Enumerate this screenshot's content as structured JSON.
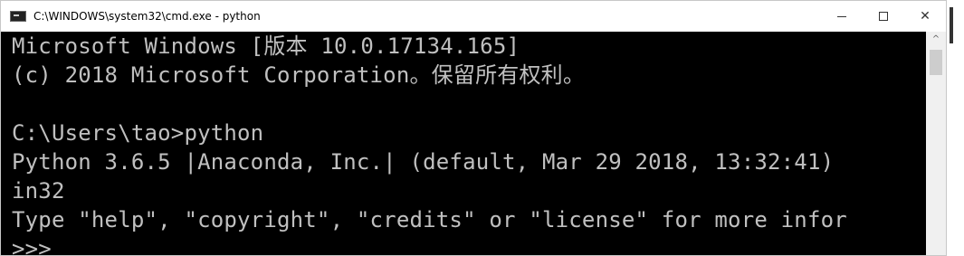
{
  "window": {
    "title": "C:\\WINDOWS\\system32\\cmd.exe - python",
    "icon": "cmd-icon",
    "minimize_label": "–",
    "close_label": "✕"
  },
  "console": {
    "lines": [
      "Microsoft Windows [版本 10.0.17134.165]",
      "(c) 2018 Microsoft Corporation。保留所有权利。",
      "",
      "C:\\Users\\tao>python",
      "Python 3.6.5 |Anaconda, Inc.| (default, Mar 29 2018, 13:32:41)",
      "in32",
      "Type \"help\", \"copyright\", \"credits\" or \"license\" for more infor",
      ">>>"
    ]
  },
  "scrollbar": {
    "up_arrow": "^"
  }
}
